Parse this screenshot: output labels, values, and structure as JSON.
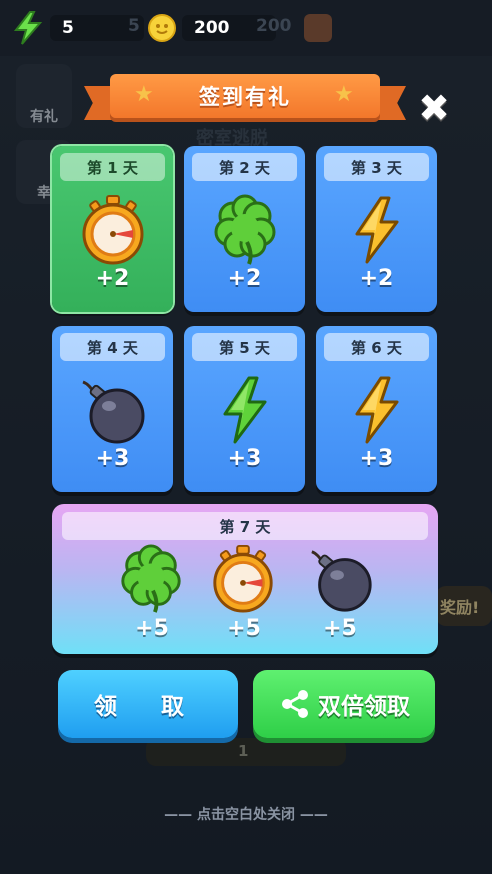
{
  "resources": {
    "energy": "5",
    "coins": "200",
    "bg_energy": "5",
    "bg_coins": "200"
  },
  "background": {
    "side_label_1": "有礼",
    "side_label_2": "幸",
    "center_label": "密室逃脱",
    "reward_tag": "奖励!",
    "bottom_count": "1"
  },
  "banner": {
    "title": "签到有礼"
  },
  "days": [
    {
      "label": "第 1 天",
      "reward": "+2",
      "icon": "stopwatch-icon",
      "state": "current"
    },
    {
      "label": "第 2 天",
      "reward": "+2",
      "icon": "clover-icon",
      "state": "locked"
    },
    {
      "label": "第 3 天",
      "reward": "+2",
      "icon": "lightning-gold-icon",
      "state": "locked"
    },
    {
      "label": "第 4 天",
      "reward": "+3",
      "icon": "bomb-icon",
      "state": "locked"
    },
    {
      "label": "第 5 天",
      "reward": "+3",
      "icon": "lightning-green-icon",
      "state": "locked"
    },
    {
      "label": "第 6 天",
      "reward": "+3",
      "icon": "lightning-gold-icon",
      "state": "locked"
    }
  ],
  "day7": {
    "label": "第 7 天",
    "rewards": [
      {
        "icon": "clover-icon",
        "amount": "+5"
      },
      {
        "icon": "stopwatch-icon",
        "amount": "+5"
      },
      {
        "icon": "bomb-icon",
        "amount": "+5"
      }
    ]
  },
  "buttons": {
    "claim": "领 取",
    "double_claim": "双倍领取"
  },
  "hint": "—— 点击空白处关闭 ——",
  "colors": {
    "card_blue": "#4a98fa",
    "card_current": "#3dba63",
    "banner": "#f5802f",
    "claim": "#28a8f4",
    "double": "#39d852"
  }
}
